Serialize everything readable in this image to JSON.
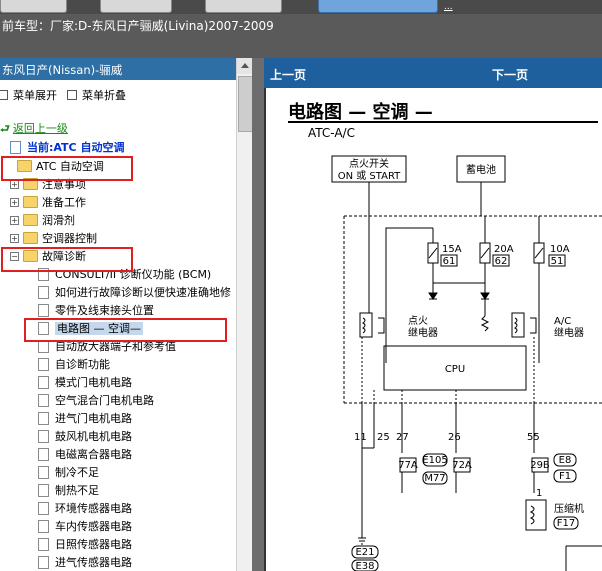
{
  "top": {
    "model_line": "前车型：厂家:D-东风日产骊威(Livina)2007-2009",
    "link_text": "..."
  },
  "left": {
    "header": "东风日产(Nissan)-骊威",
    "expand_label": "菜单展开",
    "collapse_label": "菜单折叠",
    "back_label": "返回上一级",
    "current_label": "当前:ATC 自动空调",
    "tree": [
      {
        "label": "ATC 自动空调",
        "level": 0,
        "kind": "folder"
      },
      {
        "label": "注意事项",
        "level": 1,
        "kind": "folder"
      },
      {
        "label": "准备工作",
        "level": 1,
        "kind": "folder"
      },
      {
        "label": "润滑剂",
        "level": 1,
        "kind": "folder"
      },
      {
        "label": "空调器控制",
        "level": 1,
        "kind": "folder"
      },
      {
        "label": "故障诊断",
        "level": 1,
        "kind": "folder"
      },
      {
        "label": "CONSULT/II 诊断仪功能 (BCM)",
        "level": 2,
        "kind": "doc"
      },
      {
        "label": "如何进行故障诊断以便快速准确地修",
        "level": 2,
        "kind": "doc"
      },
      {
        "label": "零件及线束接头位置",
        "level": 2,
        "kind": "doc"
      },
      {
        "label": "电路图 — 空调—",
        "level": 2,
        "kind": "doc",
        "selected": true
      },
      {
        "label": "自动放大器端子和参考值",
        "level": 2,
        "kind": "doc"
      },
      {
        "label": "自诊断功能",
        "level": 2,
        "kind": "doc"
      },
      {
        "label": "模式门电机电路",
        "level": 2,
        "kind": "doc"
      },
      {
        "label": "空气混合门电机电路",
        "level": 2,
        "kind": "doc"
      },
      {
        "label": "进气门电机电路",
        "level": 2,
        "kind": "doc"
      },
      {
        "label": "鼓风机电机电路",
        "level": 2,
        "kind": "doc"
      },
      {
        "label": "电磁离合器电路",
        "level": 2,
        "kind": "doc"
      },
      {
        "label": "制冷不足",
        "level": 2,
        "kind": "doc"
      },
      {
        "label": "制热不足",
        "level": 2,
        "kind": "doc"
      },
      {
        "label": "环境传感器电路",
        "level": 2,
        "kind": "doc"
      },
      {
        "label": "车内传感器电路",
        "level": 2,
        "kind": "doc"
      },
      {
        "label": "日照传感器电路",
        "level": 2,
        "kind": "doc"
      },
      {
        "label": "进气传感器电路",
        "level": 2,
        "kind": "doc"
      }
    ]
  },
  "right": {
    "prev_label": "上一页",
    "next_label": "下一页",
    "title": "电路图 — 空调 —",
    "subtitle": "ATC-A/C",
    "diagram": {
      "ignition_switch": "点火开关",
      "on_or_start": "ON 或 START",
      "battery": "蓄电池",
      "fuse1_amp": "15A",
      "fuse1_num": "61",
      "fuse2_amp": "20A",
      "fuse2_num": "62",
      "fuse3_amp": "10A",
      "fuse3_num": "51",
      "relay1_a": "点火",
      "relay1_b": "继电器",
      "relay2_a": "A/C",
      "relay2_b": "继电器",
      "cpu": "CPU",
      "pin1": "11",
      "pin2": "25",
      "pin3": "27",
      "pin4": "26",
      "pin5": "55",
      "conn_a": "77A",
      "conn_b": "E105",
      "conn_c": "M77",
      "conn_d": "72A",
      "conn_e": "29B",
      "conn_f": "E8",
      "conn_g": "F1",
      "compressor": "压缩机",
      "conn_h": "F17",
      "conn_i": "E21",
      "conn_j": "E38",
      "pin6": "1"
    }
  },
  "colors": {
    "header_blue": "#2e6fa6",
    "nav_blue": "#1e5f9e",
    "highlight": "#e02020",
    "selected_bg": "#c5d7ec"
  }
}
